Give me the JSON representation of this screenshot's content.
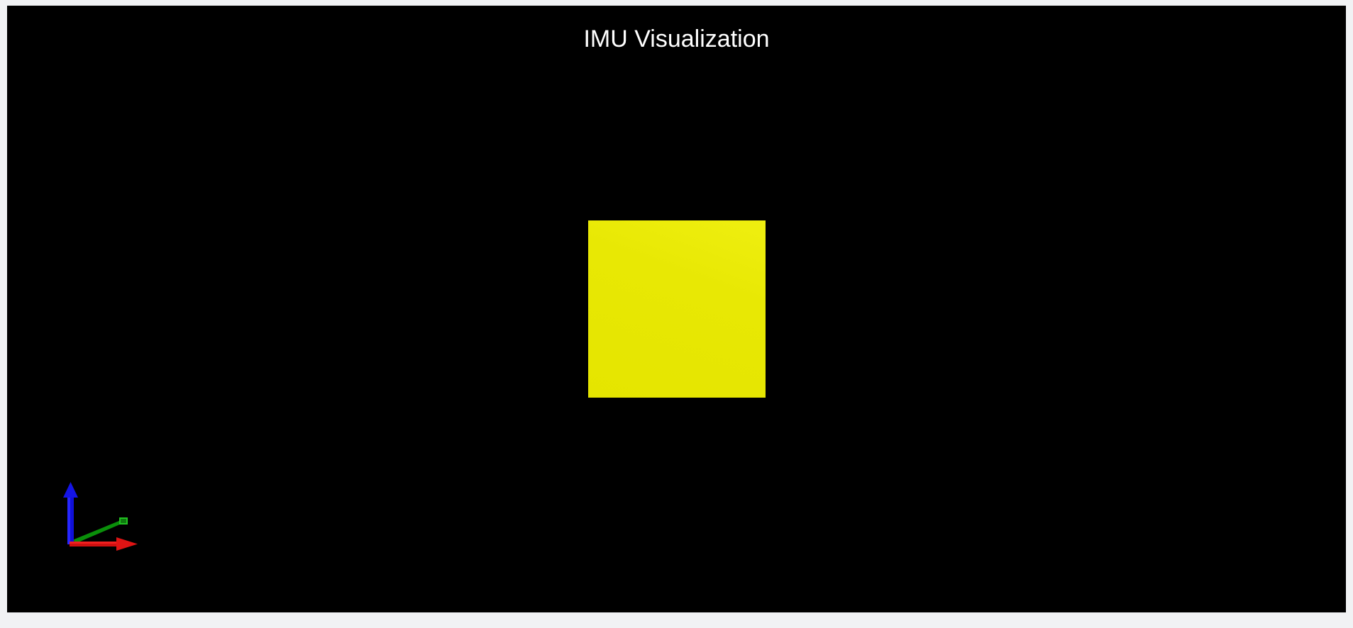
{
  "viewer": {
    "title": "IMU Visualization",
    "background_color": "#000000",
    "object": {
      "shape": "cube",
      "color": "#e6e600",
      "view": "front"
    },
    "axes_helper": {
      "x_axis_color": "#e01010",
      "y_axis_color": "#0aa00a",
      "z_axis_color": "#1010e0"
    }
  }
}
